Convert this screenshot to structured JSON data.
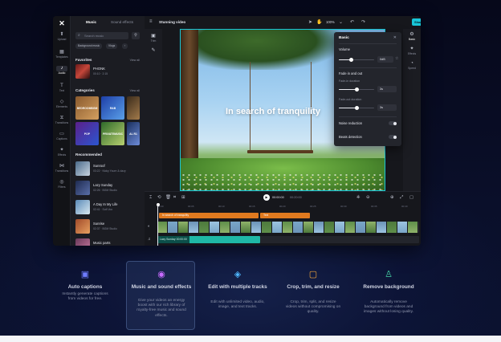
{
  "colors": {
    "accent": "#18c6d8",
    "text_clip": "#e07a1f",
    "audio_clip": "#1fb8a6",
    "page_background": "#07091a"
  },
  "left_rail": [
    {
      "label": "Upload",
      "icon": "upload-icon"
    },
    {
      "label": "Templates",
      "icon": "templates-icon"
    },
    {
      "label": "Audio",
      "icon": "audio-icon"
    },
    {
      "label": "Text",
      "icon": "text-icon"
    },
    {
      "label": "Elements",
      "icon": "elements-icon"
    },
    {
      "label": "Transitions",
      "icon": "transitions-icon"
    },
    {
      "label": "Captions",
      "icon": "captions-icon"
    },
    {
      "label": "Effects",
      "icon": "effects-icon"
    },
    {
      "label": "Transitions",
      "icon": "transitions-icon"
    },
    {
      "label": "Filters",
      "icon": "filters-icon"
    }
  ],
  "panel": {
    "tabs": [
      "Music",
      "Sound effects"
    ],
    "search_placeholder": "Search music",
    "chips": [
      "Background music",
      "Vlogs"
    ],
    "favorites_title": "Favorites",
    "categories_title": "Categories",
    "recommended_title": "Recommended",
    "view_all": "View all",
    "favorite": {
      "title": "PHONK",
      "sub": "00:10 · 2:15"
    },
    "categories": [
      "BEDROOMBGM",
      "R&B",
      "",
      "",
      "POP",
      "PRIVATEMUSIC",
      "",
      "AL R1"
    ],
    "recommended": [
      {
        "title": "Sunroof",
        "sub": "03:22 · Nicky Youre & dazy"
      },
      {
        "title": "Lazy Sunday",
        "sub": "02:26 · BGM Studio"
      },
      {
        "title": "A Day In My Life",
        "sub": "02:41 · Soft Vox"
      },
      {
        "title": "Sunrise",
        "sub": "02:37 · BGM Studio"
      },
      {
        "title": "Music parts",
        "sub": ""
      }
    ]
  },
  "topbar": {
    "project_name": "Stunning video",
    "zoom": "100%",
    "export_label": "Share"
  },
  "tools": [
    "Trim",
    "Edit"
  ],
  "preview": {
    "overlay_text": "In search of tranquility"
  },
  "right_rail": [
    {
      "label": "Basic",
      "icon": "basic-icon"
    },
    {
      "label": "Effects",
      "icon": "effects-icon"
    },
    {
      "label": "Speed",
      "icon": "speed-icon"
    }
  ],
  "basic_panel": {
    "title": "Basic",
    "volume_label": "Volume",
    "volume_value": "0dB",
    "volume_level": 0.35,
    "fade_label": "Fade in and out",
    "fade_in_label": "Fade-in duration",
    "fade_in_value": "3s",
    "fade_in_level": 0.5,
    "fade_out_label": "Fade-out duration",
    "fade_out_value": "3s",
    "fade_out_level": 0.5,
    "noise_label": "Noise reduction",
    "beats_label": "Beats detection"
  },
  "timeline": {
    "time_current": "00:00:00",
    "time_total": "00:20:00",
    "ruler": [
      "00:00",
      "00:05",
      "00:10",
      "00:15",
      "00:20",
      "00:25",
      "00:30",
      "00:35",
      "00:40"
    ],
    "text_clip_1": "In search of tranquility",
    "text_clip_2": "Text",
    "audio_label": "Lazy Sunday",
    "audio_time": "00:00:00"
  },
  "features": [
    {
      "title": "Auto captions",
      "desc": "Instantly generate captions from videos for free.",
      "icon": "auto-captions-icon",
      "color": "#6f7dff"
    },
    {
      "title": "Music and sound effects",
      "desc": "Give your videos an energy boost with our rich library of royalty-free music and sound effects.",
      "icon": "music-icon",
      "color": "#c86bff"
    },
    {
      "title": "Edit with multiple tracks",
      "desc": "Edit with unlimited video, audio, image, and text tracks.",
      "icon": "layers-icon",
      "color": "#4fb8ff"
    },
    {
      "title": "Crop, trim, and resize",
      "desc": "Crop, trim, split, and resize videos without compromising on quality.",
      "icon": "crop-icon",
      "color": "#f0a43a"
    },
    {
      "title": "Remove background",
      "desc": "Automatically remove background from videos and images without losing quality.",
      "icon": "remove-background-icon",
      "color": "#45d3a5"
    }
  ]
}
